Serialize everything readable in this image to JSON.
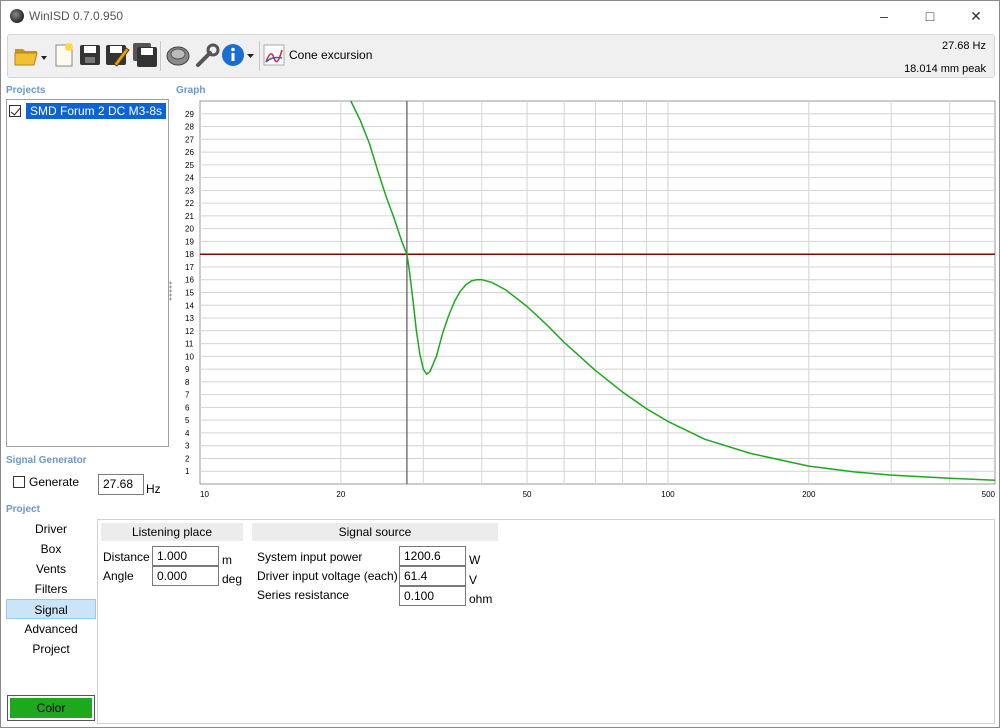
{
  "window": {
    "title": "WinISD 0.7.0.950"
  },
  "toolbar": {
    "buttons": [
      "open-icon",
      "new-icon",
      "save-icon",
      "edit-icon",
      "save-all-icon",
      "driver-icon",
      "wrench-icon",
      "info-icon"
    ],
    "graph_selector_label": "Cone excursion",
    "readout_freq": "27.68 Hz",
    "readout_value": "18.014 mm peak"
  },
  "projects": {
    "label": "Projects",
    "items": [
      {
        "name": "SMD Forum 2 DC M3-8s",
        "checked": true
      }
    ]
  },
  "graph": {
    "label": "Graph"
  },
  "signal_generator": {
    "label": "Signal Generator",
    "generate_label": "Generate",
    "frequency": "27.68",
    "unit": "Hz"
  },
  "project_section": {
    "label": "Project"
  },
  "nav": {
    "items": [
      "Driver",
      "Box",
      "Vents",
      "Filters",
      "Signal",
      "Advanced",
      "Project"
    ],
    "active": "Signal"
  },
  "listening": {
    "header": "Listening place",
    "distance_label": "Distance",
    "distance_value": "1.000",
    "distance_unit": "m",
    "angle_label": "Angle",
    "angle_value": "0.000",
    "angle_unit": "deg"
  },
  "signal_source": {
    "header": "Signal source",
    "power_label": "System input power",
    "power_value": "1200.6",
    "power_unit": "W",
    "voltage_label": "Driver input voltage (each)",
    "voltage_value": "61.4",
    "voltage_unit": "V",
    "resistance_label": "Series resistance",
    "resistance_value": "0.100",
    "resistance_unit": "ohm"
  },
  "color_button": {
    "label": "Color",
    "color": "#1ea81e"
  },
  "chart_data": {
    "type": "line",
    "title": "",
    "xlabel": "",
    "ylabel": "",
    "x_scale": "log",
    "xlim": [
      10,
      500
    ],
    "ylim": [
      0,
      30
    ],
    "x_ticks": [
      10,
      20,
      50,
      100,
      200,
      500
    ],
    "y_ticks": [
      1,
      2,
      3,
      4,
      5,
      6,
      7,
      8,
      9,
      10,
      11,
      12,
      13,
      14,
      15,
      16,
      17,
      18,
      19,
      20,
      21,
      22,
      23,
      24,
      25,
      26,
      27,
      28,
      29
    ],
    "grid": true,
    "cursor_x": 27.68,
    "limit_line_y": 18,
    "colors": {
      "series": "#1ea81e",
      "limit": "#8b0000",
      "cursor": "#555555"
    },
    "series": [
      {
        "x": [
          21,
          22,
          23,
          24,
          25,
          26,
          27,
          27.68,
          28,
          28.5,
          29,
          29.5,
          30,
          30.5,
          31,
          32,
          33,
          34,
          35,
          36,
          37,
          38,
          39,
          40,
          42,
          45,
          50,
          55,
          60,
          70,
          80,
          90,
          100,
          120,
          150,
          200,
          250,
          300,
          400,
          500
        ],
        "y": [
          30,
          28.5,
          26.7,
          24.5,
          22.5,
          20.8,
          19.0,
          18.0,
          16.8,
          14.5,
          12.0,
          10.2,
          9.0,
          8.6,
          8.8,
          10.0,
          11.8,
          13.2,
          14.3,
          15.1,
          15.6,
          15.9,
          16.0,
          16.0,
          15.8,
          15.2,
          13.9,
          12.5,
          11.1,
          8.9,
          7.2,
          5.9,
          4.9,
          3.5,
          2.4,
          1.4,
          0.95,
          0.7,
          0.45,
          0.3
        ]
      }
    ]
  }
}
